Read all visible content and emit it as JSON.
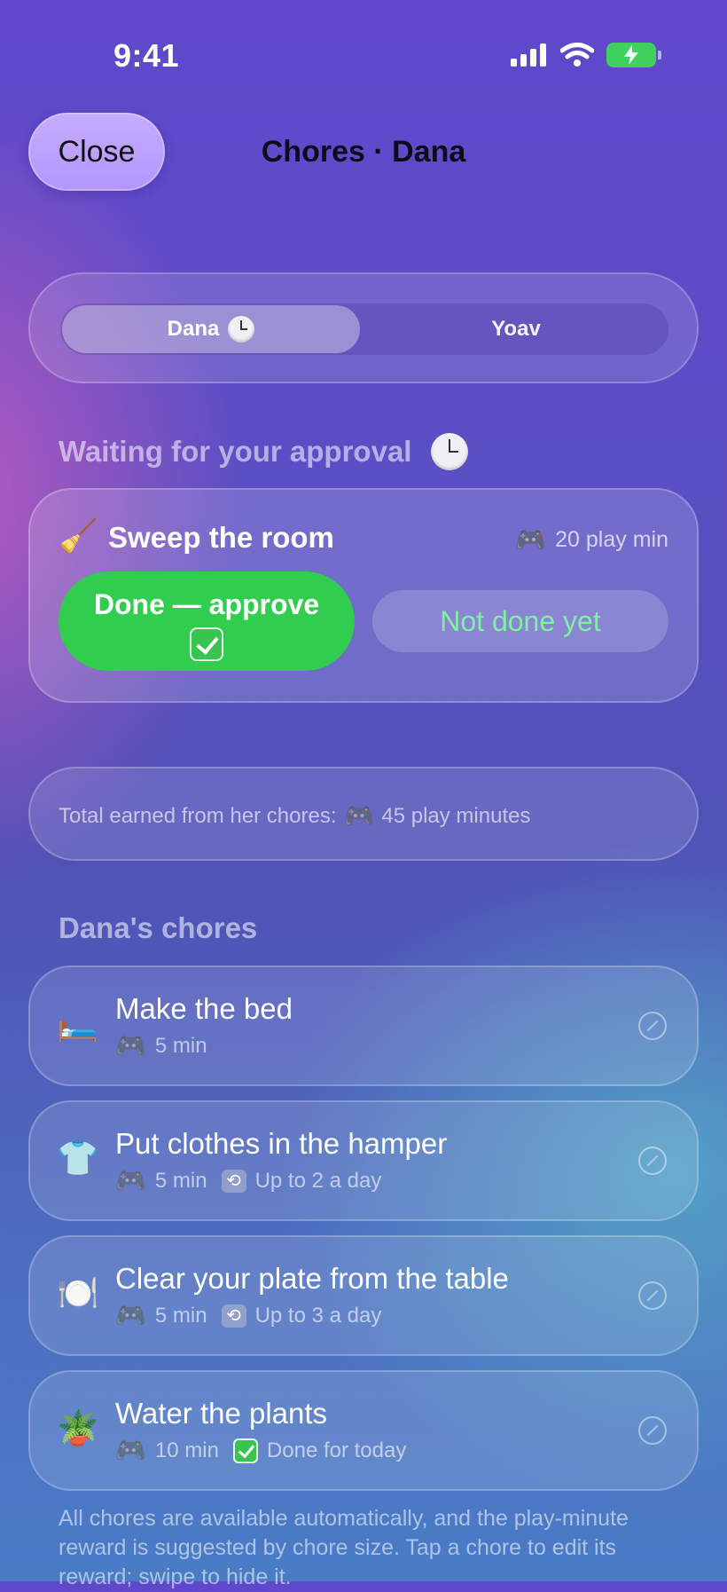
{
  "status": {
    "time": "9:41"
  },
  "header": {
    "close_label": "Close",
    "title": "Chores · Dana"
  },
  "tabs": [
    {
      "label": "Dana",
      "active": true,
      "badge_icon": "clock-icon"
    },
    {
      "label": "Yoav",
      "active": false
    }
  ],
  "approval_section": {
    "title": "Waiting for your approval",
    "item": {
      "icon": "broom-icon",
      "name": "Sweep the room",
      "reward": "20 play min",
      "approve_label": "Done — approve",
      "reject_label": "Not done yet"
    }
  },
  "total": {
    "prefix": "Total earned from her chores:",
    "value": "45 play minutes"
  },
  "chores_section": {
    "title": "Dana's chores",
    "items": [
      {
        "icon": "bed-icon",
        "emoji": "🛏️",
        "name": "Make the bed",
        "reward": "5 min",
        "extra": "",
        "extra_icon": ""
      },
      {
        "icon": "shirt-icon",
        "emoji": "👕",
        "name": "Put clothes in the hamper",
        "reward": "5 min",
        "extra": "Up to 2 a day",
        "extra_icon": "repeat-icon"
      },
      {
        "icon": "plate-icon",
        "emoji": "🍽️",
        "name": "Clear your plate from the table",
        "reward": "5 min",
        "extra": "Up to 3 a day",
        "extra_icon": "repeat-icon"
      },
      {
        "icon": "plant-icon",
        "emoji": "🪴",
        "name": "Water the plants",
        "reward": "10 min",
        "extra": "Done for today",
        "extra_icon": "check-icon"
      }
    ]
  },
  "footer": {
    "text": "All chores are available automatically, and the play-minute reward is suggested by chore size. Tap a chore to edit its reward; swipe to hide it."
  },
  "colors": {
    "approve": "#31cd4e",
    "not_done_text": "#7df0a6",
    "close_button": "#b396ff",
    "battery": "#3fd15c"
  }
}
